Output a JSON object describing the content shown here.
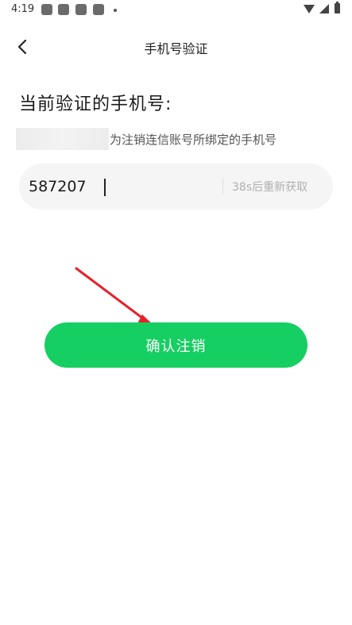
{
  "status_bar": {
    "time": "4:19"
  },
  "header": {
    "title": "手机号验证",
    "back_icon": "chevron-left-icon"
  },
  "verify": {
    "heading": "当前验证的手机号:",
    "hint": "为注销连信账号所绑定的手机号"
  },
  "code": {
    "value": "587207",
    "resend_label": "38s后重新获取"
  },
  "confirm": {
    "label": "确认注销"
  },
  "colors": {
    "accent": "#15cf62",
    "annotation_arrow": "#e8202a",
    "input_bg": "#f5f5f5"
  }
}
